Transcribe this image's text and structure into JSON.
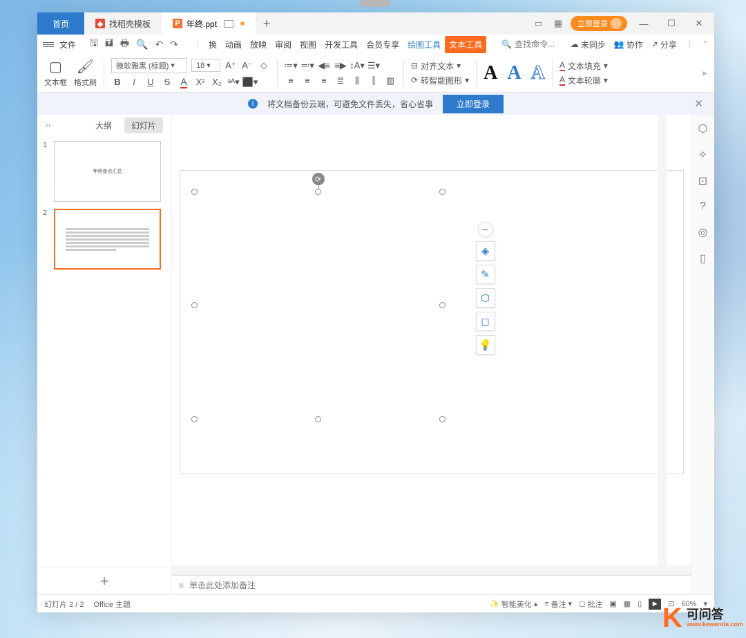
{
  "titlebar": {
    "home": "首页",
    "tab1": "找稻壳模板",
    "tab2": "年终.ppt",
    "login": "立即登录"
  },
  "menubar": {
    "file": "文件",
    "tabs": [
      "换",
      "动画",
      "放映",
      "审阅",
      "视图",
      "开发工具",
      "会员专享"
    ],
    "draw": "绘图工具",
    "text": "文本工具",
    "search_placeholder": "查找命令...",
    "unsync": "未同步",
    "collab": "协作",
    "share": "分享"
  },
  "toolbar": {
    "textbox": "文本框",
    "format_painter": "格式刷",
    "font": "微软雅黑 (标题)",
    "size": "18",
    "align_text": "对齐文本",
    "smart_graphic": "转智能图形",
    "text_fill": "文本填充",
    "text_outline": "文本轮廓"
  },
  "banner": {
    "msg": "将文档备份云端，可避免文件丢失，省心省事",
    "btn": "立即登录"
  },
  "sidepane": {
    "outline": "大纲",
    "slides": "幻灯片",
    "thumb1_title": "年终盘点汇总"
  },
  "notes": {
    "placeholder": "单击此处添加备注"
  },
  "statusbar": {
    "slide": "幻灯片 2 / 2",
    "theme": "Office 主题",
    "beautify": "智能美化",
    "notes": "备注",
    "comments": "批注",
    "zoom": "60%"
  },
  "watermark": {
    "cn": "可问答",
    "en": "www.kewenda.com"
  }
}
